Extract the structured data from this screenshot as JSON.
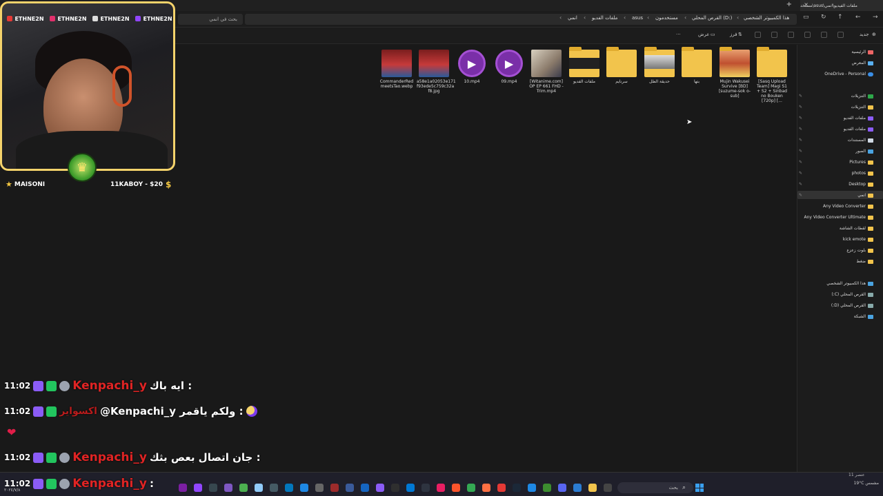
{
  "tabs": {
    "active_title": "ملفات الفيديو\\انمي\\asus\\مستخد",
    "new_tab": "+",
    "close": "×"
  },
  "nav": {
    "search_placeholder": "بحث في انمي",
    "breadcrumbs": [
      "هذا الكمبيوتر الشخصي",
      "القرص المحلي (D:)",
      "مستخدمون",
      "asus",
      "ملفات الفديو",
      "انمي"
    ]
  },
  "toolbar": {
    "new_label": "جديد",
    "sort_label": "فرز",
    "view_label": "عرض",
    "more": "···"
  },
  "files": [
    {
      "name": "CommanderRed meetsTao.webp",
      "kind": "image"
    },
    {
      "name": "a58e1a02053e171 f93ede5c759c32a f8.jpg",
      "kind": "image"
    },
    {
      "name": "10.mp4",
      "kind": "video"
    },
    {
      "name": "09.mp4",
      "kind": "video"
    },
    {
      "name": "[Witanime.com] OP EP 661 FHD - Trim.mp4",
      "kind": "image2"
    },
    {
      "name": "ملفات الفديو",
      "kind": "folder"
    },
    {
      "name": "سرنايم",
      "kind": "folder"
    },
    {
      "name": "حديقة الظل",
      "kind": "folder"
    },
    {
      "name": "بتها",
      "kind": "folder"
    },
    {
      "name": "Mujin Wakusei Survive [BD][suzume-sok o-sub]",
      "kind": "image3"
    },
    {
      "name": "[Sasq Upload Team] Magi S1 + S2 + Sinbad no Bouken [720p] [...",
      "kind": "folder"
    }
  ],
  "sidebar": {
    "top": [
      "الرئيسية",
      "المعرض",
      "OneDrive - Personal"
    ],
    "pinned": [
      "التنزيلات",
      "التنزيلات",
      "ملفات الفديو",
      "ملفات الفديو",
      "المستندات",
      "الصور",
      "Pictures",
      "photos",
      "Desktop",
      "انمي",
      "Any Video Converter",
      "Any Video Converter Ultimate",
      "لقطات الشاشة",
      "kick emote",
      "بلوت زعزع",
      "ضغط"
    ],
    "pc": [
      "هذا الكمبيوتر الشخصي",
      "القرص المحلي (C:)",
      "القرص المحلي (D:)",
      "الشبكة"
    ]
  },
  "status_bar": {
    "items_count": "11 عنصر"
  },
  "taskbar": {
    "search_placeholder": "بحث",
    "time": "11:02",
    "date": "٢٠٢٤/٧/٨",
    "weather": "19°C مشمس"
  },
  "stream": {
    "handles": [
      "ETHNE2N",
      "ETHNE2N",
      "ETHNE2N",
      "ETHNE2N"
    ],
    "sub_left": "MAISONI",
    "sub_right": "11KABOY - $20"
  },
  "chat": [
    {
      "time": "11:02",
      "user": "Kenpachi_y",
      "message": "ايه باك :"
    },
    {
      "time": "11:02",
      "user": "اكسواير",
      "message": "@Kenpachi_y ولكم ياقمر :"
    },
    {
      "time": "11:02",
      "user": "Kenpachi_y",
      "message": "جان اتصال بعص بثك :"
    },
    {
      "time": "11:02",
      "user": "Kenpachi_y",
      "message": ":"
    }
  ],
  "colors": {
    "folder": "#f2c44c",
    "accent_border": "#f5d36b",
    "chat_name": "#e02424",
    "video_icon": "#7a2fa8"
  }
}
